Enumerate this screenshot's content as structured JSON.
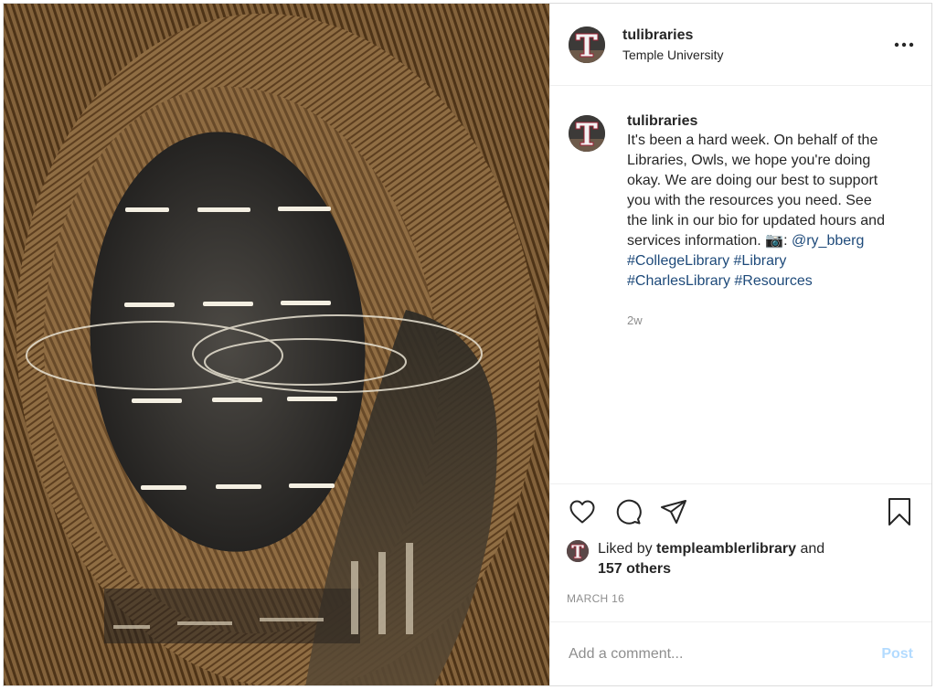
{
  "photo": {
    "alt": "Interior of a library with a wooden oval atrium and glass"
  },
  "header": {
    "username": "tulibraries",
    "subtitle": "Temple University",
    "more_icon": "more-horizontal-icon"
  },
  "caption": {
    "username": "tulibraries",
    "text": "It's been a hard week. On behalf of the Libraries, Owls, we hope you're doing okay. We are doing our best to support you with the resources you need. See the link in our bio for updated hours and services information. 📷: ",
    "mention": "@ry_bberg",
    "hashtags": [
      "#CollegeLibrary",
      "#Library",
      "#CharlesLibrary",
      "#Resources"
    ],
    "time": "2w"
  },
  "actions": {
    "like_icon": "heart-icon",
    "comment_icon": "comment-icon",
    "share_icon": "share-icon",
    "save_icon": "bookmark-icon"
  },
  "likes": {
    "prefix": "Liked by ",
    "user": "templeamblerlibrary",
    "middle": " and",
    "others": "157 others"
  },
  "date": "MARCH 16",
  "comment": {
    "placeholder": "Add a comment...",
    "post_label": "Post"
  },
  "colors": {
    "link": "#1e4a7a",
    "muted": "#8e8e8e",
    "post_disabled": "#b3dbff"
  }
}
